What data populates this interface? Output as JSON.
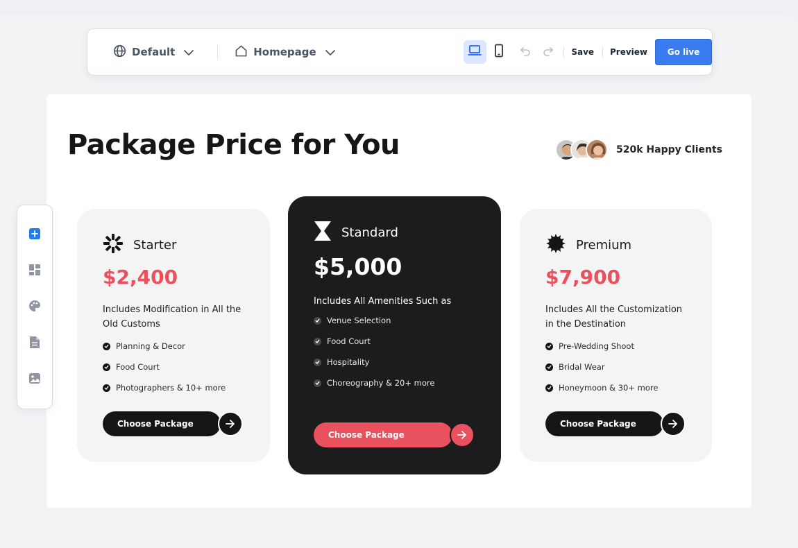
{
  "toolbar": {
    "site_selector": {
      "label": "Default",
      "icon": "globe-icon"
    },
    "page_selector": {
      "label": "Homepage",
      "icon": "home-icon"
    },
    "device_desktop": {
      "icon": "laptop-icon",
      "active": true
    },
    "device_mobile": {
      "icon": "mobile-icon"
    },
    "undo_icon": "undo-icon",
    "redo_icon": "redo-icon",
    "save_label": "Save",
    "preview_label": "Preview",
    "go_live_label": "Go live"
  },
  "sidebar": {
    "items": [
      {
        "icon": "add-block-icon",
        "active": true
      },
      {
        "icon": "layout-icon"
      },
      {
        "icon": "palette-icon"
      },
      {
        "icon": "document-icon"
      },
      {
        "icon": "image-icon"
      }
    ]
  },
  "page": {
    "title": "Package Price for You",
    "clients_label": "520k Happy Clients",
    "cards": [
      {
        "name": "Starter",
        "price": "$2,400",
        "description": "Includes Modification in All the Old Customs",
        "features": [
          "Planning & Decor",
          "Food Court",
          "Photographers & 10+ more"
        ],
        "cta": "Choose Package"
      },
      {
        "name": "Standard",
        "price": "$5,000",
        "description": "Includes All Amenities Such as",
        "features": [
          "Venue Selection",
          "Food Court",
          "Hospitality",
          "Choreography & 20+ more"
        ],
        "cta": "Choose Package"
      },
      {
        "name": "Premium",
        "price": "$7,900",
        "description": "Includes All the Customization in the Destination",
        "features": [
          "Pre-Wedding Shoot",
          "Bridal Wear",
          "Honeymoon & 30+ more"
        ],
        "cta": "Choose Package"
      }
    ]
  },
  "colors": {
    "accent_blue": "#3a7cf0",
    "price_red": "#e8515d",
    "dark_card": "#1c1c1e"
  }
}
